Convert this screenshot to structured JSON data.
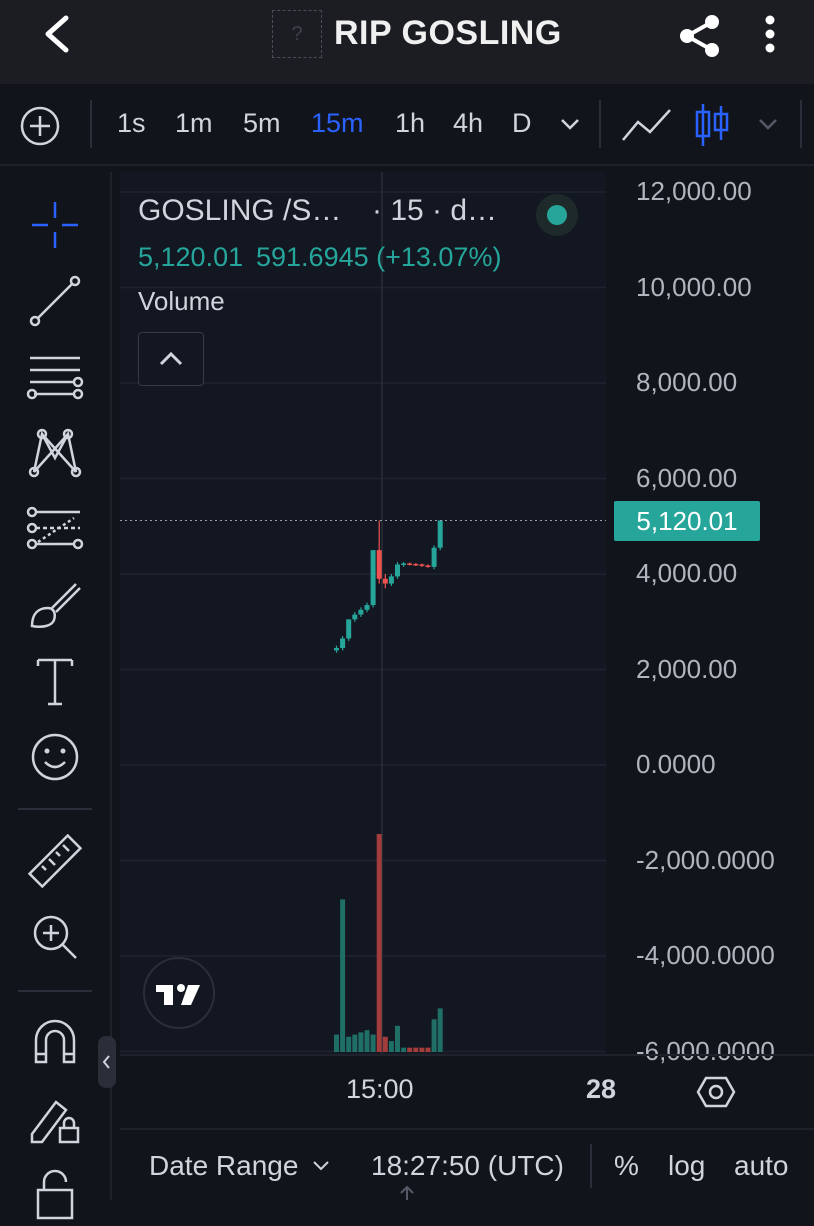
{
  "header": {
    "back_icon": "chevron-left-icon",
    "logo_placeholder": "?",
    "title": "RIP GOSLING",
    "share_icon": "share-icon",
    "more_icon": "more-vertical-icon"
  },
  "toolbar": {
    "add_icon": "plus-circle-icon",
    "timeframes": [
      "1s",
      "1m",
      "5m",
      "15m",
      "1h",
      "4h",
      "D"
    ],
    "active_timeframe": "15m",
    "line_chart_icon": "line-chart-icon",
    "candle_chart_icon": "candlestick-icon"
  },
  "tools": [
    "crosshair-icon",
    "trend-line-icon",
    "horizontal-lines-icon",
    "pattern-icon",
    "fib-icon",
    "brush-icon",
    "text-icon",
    "emoji-icon",
    "ruler-icon",
    "zoom-in-icon",
    "magnet-icon",
    "lock-drawing-icon",
    "unlock-icon"
  ],
  "legend": {
    "symbol": "GOSLING /S…",
    "interval": "· 15 · d…",
    "price": "5,120.01",
    "change": "591.6945 (+13.07%)",
    "volume_label": "Volume"
  },
  "price_axis": {
    "labels": [
      "12,000.00",
      "10,000.00",
      "8,000.00",
      "6,000.00",
      "4,000.00",
      "2,000.00",
      "0.0000",
      "-2,000.0000",
      "-4,000.0000",
      "-6,000.0000"
    ],
    "current_price": "5,120.01"
  },
  "time_axis": {
    "labels": [
      "15:00",
      "28"
    ]
  },
  "bottom_bar": {
    "date_range": "Date Range",
    "time": "18:27:50 (UTC)",
    "percent": "%",
    "log": "log",
    "auto": "auto"
  },
  "colors": {
    "up": "#26a69a",
    "down": "#ef5350",
    "active": "#2962ff",
    "price_tag": "#26a69a"
  },
  "chart_data": {
    "type": "candlestick",
    "interval": "15m",
    "ylim": [
      -6000,
      12000
    ],
    "candles": [
      {
        "o": 2400,
        "h": 2500,
        "l": 2350,
        "c": 2450
      },
      {
        "o": 2450,
        "h": 2700,
        "l": 2400,
        "c": 2650
      },
      {
        "o": 2650,
        "h": 3050,
        "l": 2600,
        "c": 3050
      },
      {
        "o": 3050,
        "h": 3200,
        "l": 3000,
        "c": 3150
      },
      {
        "o": 3150,
        "h": 3300,
        "l": 3100,
        "c": 3250
      },
      {
        "o": 3250,
        "h": 3400,
        "l": 3200,
        "c": 3350
      },
      {
        "o": 3350,
        "h": 4500,
        "l": 3300,
        "c": 4500
      },
      {
        "o": 4500,
        "h": 5120,
        "l": 3800,
        "c": 3900
      },
      {
        "o": 3900,
        "h": 4000,
        "l": 3700,
        "c": 3800
      },
      {
        "o": 3800,
        "h": 4000,
        "l": 3750,
        "c": 3950
      },
      {
        "o": 3950,
        "h": 4250,
        "l": 3900,
        "c": 4200
      },
      {
        "o": 4200,
        "h": 4250,
        "l": 4150,
        "c": 4220
      },
      {
        "o": 4220,
        "h": 4240,
        "l": 4180,
        "c": 4210
      },
      {
        "o": 4210,
        "h": 4230,
        "l": 4170,
        "c": 4200
      },
      {
        "o": 4200,
        "h": 4220,
        "l": 4150,
        "c": 4180
      },
      {
        "o": 4180,
        "h": 4200,
        "l": 4130,
        "c": 4150
      },
      {
        "o": 4150,
        "h": 4600,
        "l": 4100,
        "c": 4550
      },
      {
        "o": 4550,
        "h": 5120,
        "l": 4500,
        "c": 5120
      }
    ],
    "volumes": [
      0.08,
      0.7,
      0.07,
      0.08,
      0.09,
      0.1,
      0.08,
      1.0,
      0.07,
      0.05,
      0.12,
      0.02,
      0.02,
      0.02,
      0.02,
      0.02,
      0.15,
      0.2
    ]
  }
}
